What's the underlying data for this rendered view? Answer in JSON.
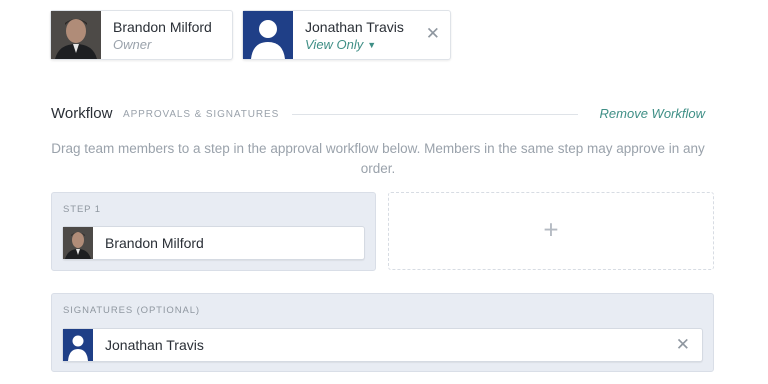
{
  "members": [
    {
      "name": "Brandon Milford",
      "role": "Owner"
    },
    {
      "name": "Jonathan Travis",
      "role": "View Only",
      "close": "✕"
    }
  ],
  "workflow": {
    "title": "Workflow",
    "subtitle": "APPROVALS & SIGNATURES",
    "remove_label": "Remove Workflow",
    "description": "Drag team members to a step in the approval workflow below. Members in the same step may approve in any order.",
    "step": {
      "label": "STEP 1",
      "member": "Brandon Milford"
    },
    "add_icon": "plus-icon",
    "add_glyph": "+",
    "signatures": {
      "label": "SIGNATURES (OPTIONAL)",
      "member": "Jonathan Travis",
      "close": "✕"
    }
  },
  "colors": {
    "accent": "#3f8f86",
    "panel_bg": "#e8ecf3",
    "avatar_blue": "#1f3f87"
  }
}
